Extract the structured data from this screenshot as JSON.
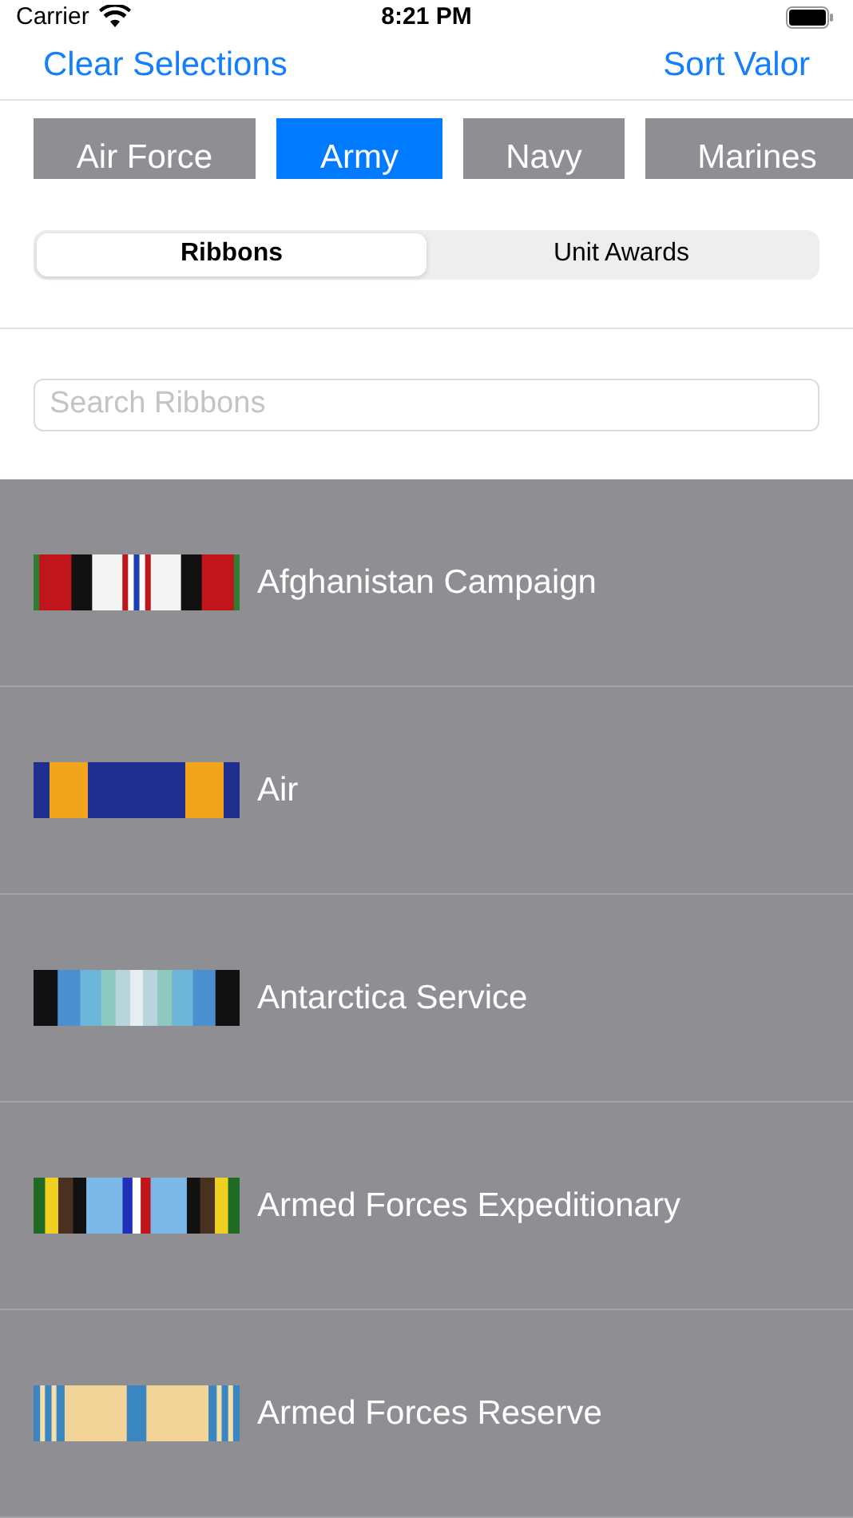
{
  "status_bar": {
    "carrier": "Carrier",
    "time": "8:21 PM"
  },
  "nav": {
    "left": "Clear Selections",
    "right": "Sort Valor"
  },
  "branches": [
    {
      "label": "Air Force",
      "selected": false
    },
    {
      "label": "Army",
      "selected": true
    },
    {
      "label": "Navy",
      "selected": false
    },
    {
      "label": "Marines",
      "selected": false
    }
  ],
  "segments": [
    {
      "label": "Ribbons",
      "selected": true
    },
    {
      "label": "Unit Awards",
      "selected": false
    }
  ],
  "search": {
    "placeholder": "Search Ribbons"
  },
  "ribbons": [
    {
      "name": "Afghanistan Campaign"
    },
    {
      "name": "Air"
    },
    {
      "name": "Antarctica Service"
    },
    {
      "name": "Armed Forces Expeditionary"
    },
    {
      "name": "Armed Forces Reserve"
    }
  ]
}
